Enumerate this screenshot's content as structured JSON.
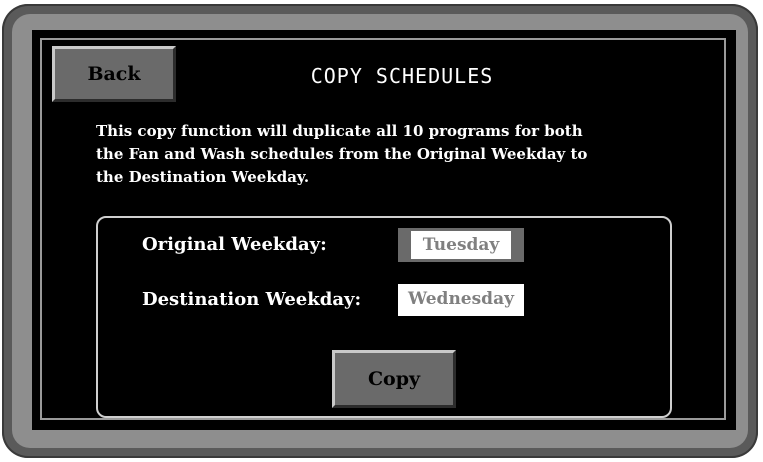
{
  "header": {
    "back_label": "Back",
    "title": "COPY SCHEDULES"
  },
  "description": {
    "line1": "This copy function will duplicate all 10 programs for both",
    "line2": "the Fan and Wash schedules from the Original Weekday to",
    "line3": "the Destination Weekday."
  },
  "form": {
    "original_label": "Original Weekday:",
    "original_value": "Tuesday",
    "destination_label": "Destination Weekday:",
    "destination_value": "Wednesday",
    "copy_label": "Copy"
  },
  "colors": {
    "screen_background": "#000000",
    "button_face": "#6a6a6a",
    "bezel": "#8e8e8e"
  }
}
